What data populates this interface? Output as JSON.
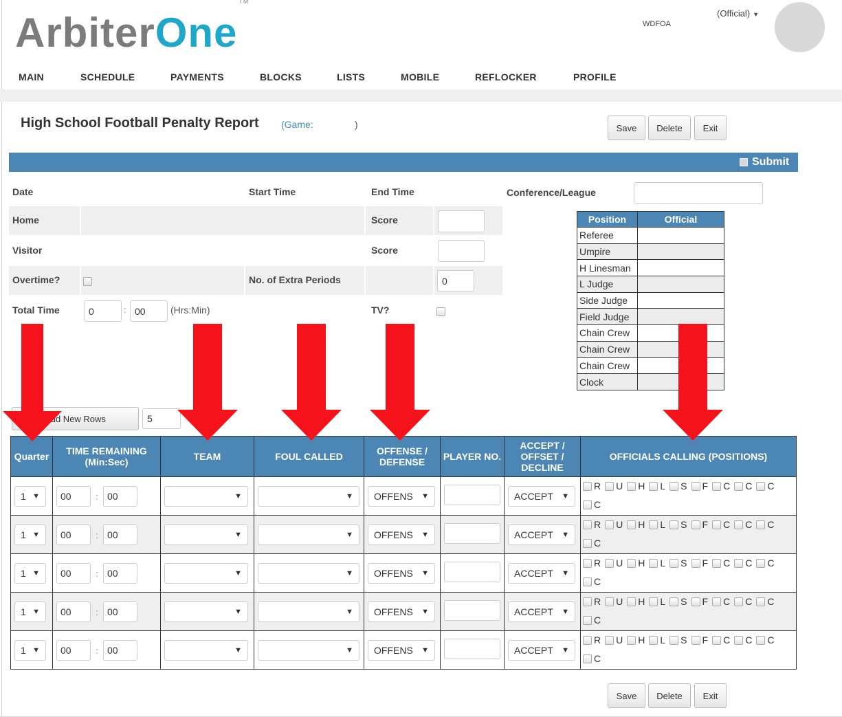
{
  "app": {
    "logo_part1": "Arbiter",
    "logo_part2": "One",
    "logo_tm": "TM",
    "org": "WDFOA",
    "role": "(Official)"
  },
  "nav": [
    "MAIN",
    "SCHEDULE",
    "PAYMENTS",
    "BLOCKS",
    "LISTS",
    "MOBILE",
    "REFLOCKER",
    "PROFILE"
  ],
  "page": {
    "title": "High School Football Penalty Report",
    "game_label": "(Game:",
    "game_close": ")"
  },
  "actions": {
    "save": "Save",
    "delete": "Delete",
    "exit": "Exit"
  },
  "submit_label": "Submit",
  "form": {
    "date_label": "Date",
    "start_time_label": "Start Time",
    "end_time_label": "End Time",
    "conference_label": "Conference/League",
    "conference_value": "",
    "home_label": "Home",
    "visitor_label": "Visitor",
    "score_label": "Score",
    "home_score": "",
    "visitor_score": "",
    "overtime_label": "Overtime?",
    "extra_periods_label": "No. of Extra Periods",
    "extra_periods_value": "0",
    "total_time_label": "Total Time",
    "total_hours": "0",
    "total_minutes": "00",
    "total_time_hint": "(Hrs:Min)",
    "tv_label": "TV?"
  },
  "officials_table": {
    "headers": [
      "Position",
      "Official"
    ],
    "positions": [
      "Referee",
      "Umpire",
      "H Linesman",
      "L Judge",
      "Side Judge",
      "Field Judge",
      "Chain Crew",
      "Chain Crew",
      "Chain Crew",
      "Clock"
    ]
  },
  "add_rows": {
    "label": "Add New Rows",
    "count": "5"
  },
  "grid": {
    "headers": [
      "Quarter",
      "TIME REMAINING (Min:Sec)",
      "TEAM",
      "FOUL CALLED",
      "OFFENSE / DEFENSE",
      "PLAYER NO.",
      "ACCEPT / OFFSET / DECLINE",
      "OFFICIALS CALLING (POSITIONS)"
    ],
    "official_codes": [
      "R",
      "U",
      "H",
      "L",
      "S",
      "F",
      "C",
      "C",
      "C",
      "C"
    ],
    "rows": [
      {
        "quarter": "1",
        "min": "00",
        "sec": "00",
        "team": "",
        "foul": "",
        "side": "OFFENS",
        "player": "",
        "decision": "ACCEPT"
      },
      {
        "quarter": "1",
        "min": "00",
        "sec": "00",
        "team": "",
        "foul": "",
        "side": "OFFENS",
        "player": "",
        "decision": "ACCEPT"
      },
      {
        "quarter": "1",
        "min": "00",
        "sec": "00",
        "team": "",
        "foul": "",
        "side": "OFFENS",
        "player": "",
        "decision": "ACCEPT"
      },
      {
        "quarter": "1",
        "min": "00",
        "sec": "00",
        "team": "",
        "foul": "",
        "side": "OFFENS",
        "player": "",
        "decision": "ACCEPT"
      },
      {
        "quarter": "1",
        "min": "00",
        "sec": "00",
        "team": "",
        "foul": "",
        "side": "OFFENS",
        "player": "",
        "decision": "ACCEPT"
      }
    ]
  },
  "colors": {
    "brand_blue": "#1fa7c9",
    "header_blue": "#4b86b4",
    "arrow_red": "#f5121a"
  }
}
